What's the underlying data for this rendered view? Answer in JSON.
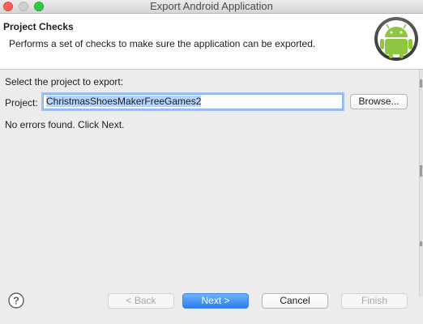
{
  "window": {
    "title": "Export Android Application"
  },
  "header": {
    "title": "Project Checks",
    "description": "Performs a set of checks to make sure the application can be exported."
  },
  "form": {
    "select_label": "Select the project to export:",
    "project_label": "Project:",
    "project_value": "ChristmasShoesMakerFreeGames2",
    "browse_label": "Browse...",
    "status_text": "No errors found. Click Next."
  },
  "footer": {
    "back_label": "< Back",
    "next_label": "Next >",
    "cancel_label": "Cancel",
    "finish_label": "Finish"
  },
  "icons": {
    "close": "close-traffic-light",
    "minimize": "minimize-traffic-light",
    "zoom": "zoom-traffic-light",
    "header_logo": "android-icon",
    "help": "help-icon"
  },
  "colors": {
    "accent": "#2d7ef0",
    "selection": "#b3d4fc",
    "android_green": "#8dc63f"
  }
}
